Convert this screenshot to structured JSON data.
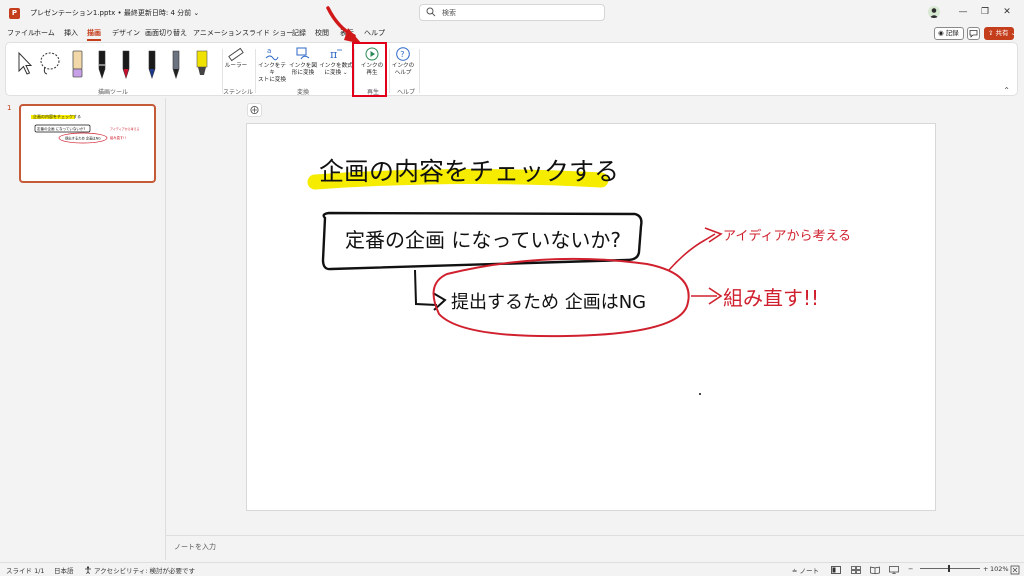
{
  "titlebar": {
    "app_icon": "P",
    "doc_title": "プレゼンテーション1.pptx • 最終更新日時: 4 分前 ⌄",
    "search_placeholder": "検索",
    "minimize": "—",
    "restore": "❐",
    "close": "✕"
  },
  "menu": {
    "tabs": [
      "ファイル",
      "ホーム",
      "挿入",
      "描画",
      "デザイン",
      "画面切り替え",
      "アニメーション",
      "スライド ショー",
      "記録",
      "校閲",
      "表示",
      "ヘルプ"
    ],
    "active_index": 3,
    "record_label": "◉ 記録",
    "share_label": "⇪ 共有 ⌄"
  },
  "ribbon": {
    "groups": {
      "drawing_tools": "描画ツール",
      "stencil": "ステンシル",
      "convert": "変換",
      "replay": "再生",
      "help": "ヘルプ"
    },
    "buttons": {
      "ruler": "ルーラー",
      "ink_to_text": [
        "インクをテキ",
        "ストに変換"
      ],
      "ink_to_shape": [
        "インクを図",
        "形に変換"
      ],
      "ink_to_math": [
        "インクを数式",
        "に変換 ⌄"
      ],
      "ink_replay": [
        "インクの",
        "再生"
      ],
      "ink_help": [
        "インクの",
        "ヘルプ"
      ]
    },
    "pen_colors": [
      "#1a1a1a",
      "#1a1a1a",
      "#c8102e",
      "#1e3a8a",
      "#374151",
      "#6b7280",
      "#f0e200"
    ],
    "highlight_color": "#e0001a"
  },
  "slides_pane": {
    "slide_number": "1"
  },
  "slide": {
    "title": "企画の内容をチェックする",
    "box_text": "定番の企画 になっていないか?",
    "circle_text": "提出するため 企画はNG",
    "note_1": "アイディアから考える",
    "note_2": "組み直す!!",
    "ink_black": "#111111",
    "ink_red": "#d0202e",
    "highlighter": "#f5ec00"
  },
  "notes": {
    "placeholder": "ノートを入力"
  },
  "status": {
    "slide_counter": "スライド 1/1",
    "language": "日本語",
    "accessibility": "アクセシビリティ: 検討が必要です",
    "notes_toggle": "≐ ノート",
    "zoom": "102%"
  }
}
